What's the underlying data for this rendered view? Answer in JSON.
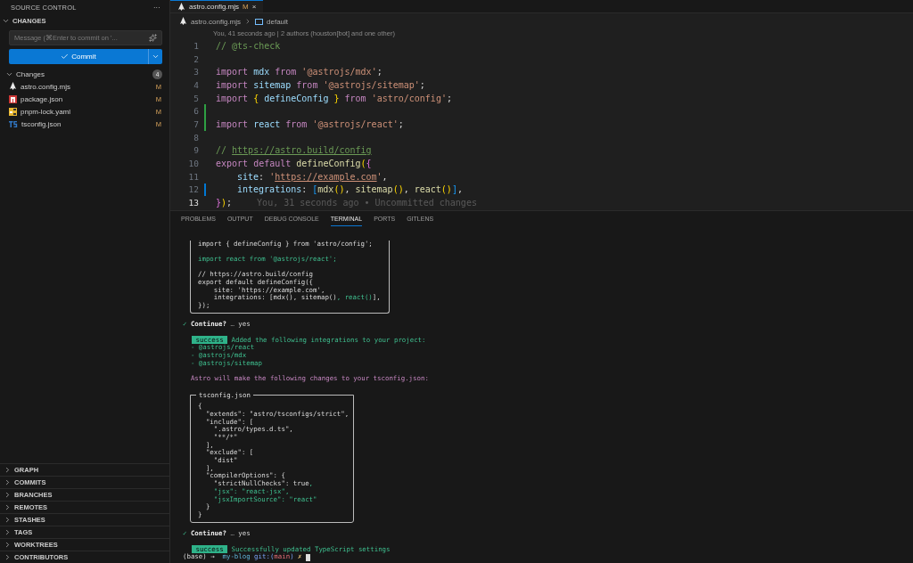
{
  "sidebar": {
    "title": "SOURCE CONTROL",
    "more": "···",
    "section": {
      "title": "CHANGES",
      "expanded": true
    },
    "message": {
      "placeholder": "Message (⌘Enter to commit on '..."
    },
    "commit": {
      "label": "Commit"
    },
    "group": {
      "label": "Changes",
      "count": "4",
      "expanded": true
    },
    "files": [
      {
        "name": "astro.config.mjs",
        "status": "M",
        "kind": "astro"
      },
      {
        "name": "package.json",
        "status": "M",
        "kind": "npm"
      },
      {
        "name": "pnpm-lock.yaml",
        "status": "M",
        "kind": "yaml"
      },
      {
        "name": "tsconfig.json",
        "status": "M",
        "kind": "ts"
      }
    ],
    "panels": [
      {
        "label": "GRAPH",
        "expanded": false
      },
      {
        "label": "COMMITS",
        "expanded": false
      },
      {
        "label": "BRANCHES",
        "expanded": false
      },
      {
        "label": "REMOTES",
        "expanded": false
      },
      {
        "label": "STASHES",
        "expanded": false
      },
      {
        "label": "TAGS",
        "expanded": false
      },
      {
        "label": "WORKTREES",
        "expanded": false
      },
      {
        "label": "CONTRIBUTORS",
        "expanded": false
      }
    ]
  },
  "editor": {
    "tabs": [
      {
        "label": "astro.config.mjs",
        "status": "M",
        "close": "×",
        "selected": true
      }
    ],
    "breadcrumb": [
      "astro.config.mjs",
      "default"
    ],
    "blame": "You, 41 seconds ago | 2 authors (houston[bot] and one other)",
    "lines": [
      {
        "number": "1",
        "current": false,
        "added": false,
        "modified": false,
        "tokens": [
          {
            "kind": "comment",
            "text": "// @ts-check"
          }
        ]
      },
      {
        "number": "2",
        "current": false,
        "added": false,
        "modified": false
      },
      {
        "number": "3",
        "current": false,
        "added": false,
        "modified": false,
        "tokens": [
          {
            "kind": "kw",
            "text": "import "
          },
          {
            "kind": "var",
            "text": "mdx "
          },
          {
            "kind": "kw",
            "text": "from "
          },
          {
            "kind": "str",
            "text": "'@astrojs/mdx'"
          },
          {
            "kind": "plain",
            "text": ";"
          }
        ]
      },
      {
        "number": "4",
        "current": false,
        "added": false,
        "modified": false,
        "tokens": [
          {
            "kind": "kw",
            "text": "import "
          },
          {
            "kind": "var",
            "text": "sitemap "
          },
          {
            "kind": "kw",
            "text": "from "
          },
          {
            "kind": "str",
            "text": "'@astrojs/sitemap'"
          },
          {
            "kind": "plain",
            "text": ";"
          }
        ]
      },
      {
        "number": "5",
        "current": false,
        "added": false,
        "modified": false,
        "tokens": [
          {
            "kind": "kw",
            "text": "import "
          },
          {
            "kind": "brace1",
            "text": "{ "
          },
          {
            "kind": "var",
            "text": "defineConfig "
          },
          {
            "kind": "brace1",
            "text": "} "
          },
          {
            "kind": "kw",
            "text": "from "
          },
          {
            "kind": "str",
            "text": "'astro/config'"
          },
          {
            "kind": "plain",
            "text": ";"
          }
        ]
      },
      {
        "number": "6",
        "current": false,
        "added": true,
        "modified": false
      },
      {
        "number": "7",
        "current": false,
        "added": true,
        "modified": false,
        "tokens": [
          {
            "kind": "kw",
            "text": "import "
          },
          {
            "kind": "var",
            "text": "react "
          },
          {
            "kind": "kw",
            "text": "from "
          },
          {
            "kind": "str",
            "text": "'@astrojs/react'"
          },
          {
            "kind": "plain",
            "text": ";"
          }
        ]
      },
      {
        "number": "8",
        "current": false,
        "added": false,
        "modified": false
      },
      {
        "number": "9",
        "current": false,
        "added": false,
        "modified": false,
        "tokens": [
          {
            "kind": "comment",
            "text": "// "
          },
          {
            "kind": "commentlink",
            "text": "https://astro.build/config"
          }
        ]
      },
      {
        "number": "10",
        "current": false,
        "added": false,
        "modified": false,
        "tokens": [
          {
            "kind": "kw",
            "text": "export default "
          },
          {
            "kind": "fn",
            "text": "defineConfig"
          },
          {
            "kind": "brace1",
            "text": "("
          },
          {
            "kind": "brace2",
            "text": "{"
          }
        ]
      },
      {
        "number": "11",
        "current": false,
        "added": false,
        "modified": false,
        "indent": true,
        "tokens": [
          {
            "kind": "var",
            "text": "site"
          },
          {
            "kind": "plain",
            "text": ": "
          },
          {
            "kind": "str",
            "text": "'"
          },
          {
            "kind": "strlink",
            "text": "https://example.com"
          },
          {
            "kind": "str",
            "text": "'"
          },
          {
            "kind": "plain",
            "text": ","
          }
        ]
      },
      {
        "number": "12",
        "current": false,
        "added": false,
        "modified": true,
        "indent": true,
        "tokens": [
          {
            "kind": "var",
            "text": "integrations"
          },
          {
            "kind": "plain",
            "text": ": "
          },
          {
            "kind": "brace3",
            "text": "["
          },
          {
            "kind": "fn",
            "text": "mdx"
          },
          {
            "kind": "brace1",
            "text": "()"
          },
          {
            "kind": "plain",
            "text": ", "
          },
          {
            "kind": "fn",
            "text": "sitemap"
          },
          {
            "kind": "brace1",
            "text": "()"
          },
          {
            "kind": "plain",
            "text": ", "
          },
          {
            "kind": "fn",
            "text": "react"
          },
          {
            "kind": "brace1",
            "text": "()"
          },
          {
            "kind": "brace3",
            "text": "]"
          },
          {
            "kind": "plain",
            "text": ","
          }
        ]
      },
      {
        "number": "13",
        "current": true,
        "added": false,
        "modified": false,
        "tokens": [
          {
            "kind": "brace2",
            "text": "}"
          },
          {
            "kind": "brace1",
            "text": ")"
          },
          {
            "kind": "plain",
            "text": ";"
          }
        ],
        "inline_blame": "You, 31 seconds ago • Uncommitted changes"
      }
    ]
  },
  "panel": {
    "tabs": [
      {
        "label": "PROBLEMS",
        "selected": false
      },
      {
        "label": "OUTPUT",
        "selected": false
      },
      {
        "label": "DEBUG CONSOLE",
        "selected": false
      },
      {
        "label": "TERMINAL",
        "selected": true
      },
      {
        "label": "PORTS",
        "selected": false
      },
      {
        "label": "GITLENS",
        "selected": false
      }
    ],
    "terminal": [
      {
        "kind": "box_tail",
        "lines": [
          {
            "kind": "text",
            "tokens": [
              {
                "kind": "plain",
                "text": "import { defineConfig } from 'astro/config';"
              }
            ]
          },
          {
            "kind": "blank"
          },
          {
            "kind": "text",
            "tokens": [
              {
                "kind": "green",
                "text": "import react from '@astrojs/react';"
              }
            ]
          },
          {
            "kind": "blank"
          },
          {
            "kind": "text",
            "tokens": [
              {
                "kind": "plain",
                "text": "// https://astro.build/config"
              }
            ]
          },
          {
            "kind": "text",
            "tokens": [
              {
                "kind": "plain",
                "text": "export default defineConfig({"
              }
            ]
          },
          {
            "kind": "text",
            "tokens": [
              {
                "kind": "plain",
                "text": "    site: 'https://example.com',"
              }
            ]
          },
          {
            "kind": "text",
            "tokens": [
              {
                "kind": "plain",
                "text": "    integrations: [mdx(), sitemap()"
              },
              {
                "kind": "green",
                "text": ", react()"
              },
              {
                "kind": "plain",
                "text": "],"
              }
            ]
          },
          {
            "kind": "text",
            "tokens": [
              {
                "kind": "plain",
                "text": "});"
              }
            ]
          }
        ]
      },
      {
        "kind": "blank"
      },
      {
        "kind": "text",
        "tokens": [
          {
            "kind": "check",
            "text": "✓ "
          },
          {
            "kind": "bold",
            "text": "Continue?"
          },
          {
            "kind": "dim",
            "text": " … "
          },
          {
            "kind": "plain",
            "text": "yes"
          }
        ]
      },
      {
        "kind": "blank"
      },
      {
        "kind": "text",
        "indent": true,
        "tokens": [
          {
            "kind": "badge",
            "text": " success "
          },
          {
            "kind": "green",
            "text": " Added the following integrations to your project:"
          }
        ]
      },
      {
        "kind": "text",
        "tokens": [
          {
            "kind": "green",
            "text": "  - @astrojs/react"
          }
        ]
      },
      {
        "kind": "text",
        "tokens": [
          {
            "kind": "green",
            "text": "  - @astrojs/mdx"
          }
        ]
      },
      {
        "kind": "text",
        "tokens": [
          {
            "kind": "green",
            "text": "  - @astrojs/sitemap"
          }
        ]
      },
      {
        "kind": "blank"
      },
      {
        "kind": "text",
        "tokens": [
          {
            "kind": "magenta",
            "text": "  Astro will make the following changes to your tsconfig.json:"
          }
        ]
      },
      {
        "kind": "blank"
      },
      {
        "kind": "box",
        "title": "tsconfig.json",
        "lines": [
          {
            "kind": "text",
            "tokens": [
              {
                "kind": "plain",
                "text": "{"
              }
            ]
          },
          {
            "kind": "text",
            "tokens": [
              {
                "kind": "plain",
                "text": "  \"extends\": \"astro/tsconfigs/strict\","
              }
            ]
          },
          {
            "kind": "text",
            "tokens": [
              {
                "kind": "plain",
                "text": "  \"include\": ["
              }
            ]
          },
          {
            "kind": "text",
            "tokens": [
              {
                "kind": "plain",
                "text": "    \".astro/types.d.ts\","
              }
            ]
          },
          {
            "kind": "text",
            "tokens": [
              {
                "kind": "plain",
                "text": "    \"**/*\""
              }
            ]
          },
          {
            "kind": "text",
            "tokens": [
              {
                "kind": "plain",
                "text": "  ],"
              }
            ]
          },
          {
            "kind": "text",
            "tokens": [
              {
                "kind": "plain",
                "text": "  \"exclude\": ["
              }
            ]
          },
          {
            "kind": "text",
            "tokens": [
              {
                "kind": "plain",
                "text": "    \"dist\""
              }
            ]
          },
          {
            "kind": "text",
            "tokens": [
              {
                "kind": "plain",
                "text": "  ],"
              }
            ]
          },
          {
            "kind": "text",
            "tokens": [
              {
                "kind": "plain",
                "text": "  \"compilerOptions\": {"
              }
            ]
          },
          {
            "kind": "text",
            "tokens": [
              {
                "kind": "plain",
                "text": "    \"strictNullChecks\": true"
              },
              {
                "kind": "green",
                "text": ","
              }
            ]
          },
          {
            "kind": "text",
            "tokens": [
              {
                "kind": "green",
                "text": "    \"jsx\": \"react-jsx\","
              }
            ]
          },
          {
            "kind": "text",
            "tokens": [
              {
                "kind": "green",
                "text": "    \"jsxImportSource\": \"react\""
              }
            ]
          },
          {
            "kind": "text",
            "tokens": [
              {
                "kind": "plain",
                "text": "  }"
              }
            ]
          },
          {
            "kind": "text",
            "tokens": [
              {
                "kind": "plain",
                "text": "}"
              }
            ]
          }
        ]
      },
      {
        "kind": "blank"
      },
      {
        "kind": "text",
        "tokens": [
          {
            "kind": "check",
            "text": "✓ "
          },
          {
            "kind": "bold",
            "text": "Continue?"
          },
          {
            "kind": "dim",
            "text": " … "
          },
          {
            "kind": "plain",
            "text": "yes"
          }
        ]
      },
      {
        "kind": "blank"
      },
      {
        "kind": "text",
        "indent": true,
        "tokens": [
          {
            "kind": "badge",
            "text": " success "
          },
          {
            "kind": "green",
            "text": " Successfully updated TypeScript settings"
          }
        ]
      },
      {
        "kind": "prompt",
        "tokens": [
          {
            "kind": "plain",
            "text": "(base) → "
          },
          {
            "kind": "cyan",
            "text": " my-blog "
          },
          {
            "kind": "blue",
            "text": "git:("
          },
          {
            "kind": "red",
            "text": "main"
          },
          {
            "kind": "blue",
            "text": ") "
          },
          {
            "kind": "yellow",
            "text": "✗ "
          }
        ]
      }
    ]
  }
}
